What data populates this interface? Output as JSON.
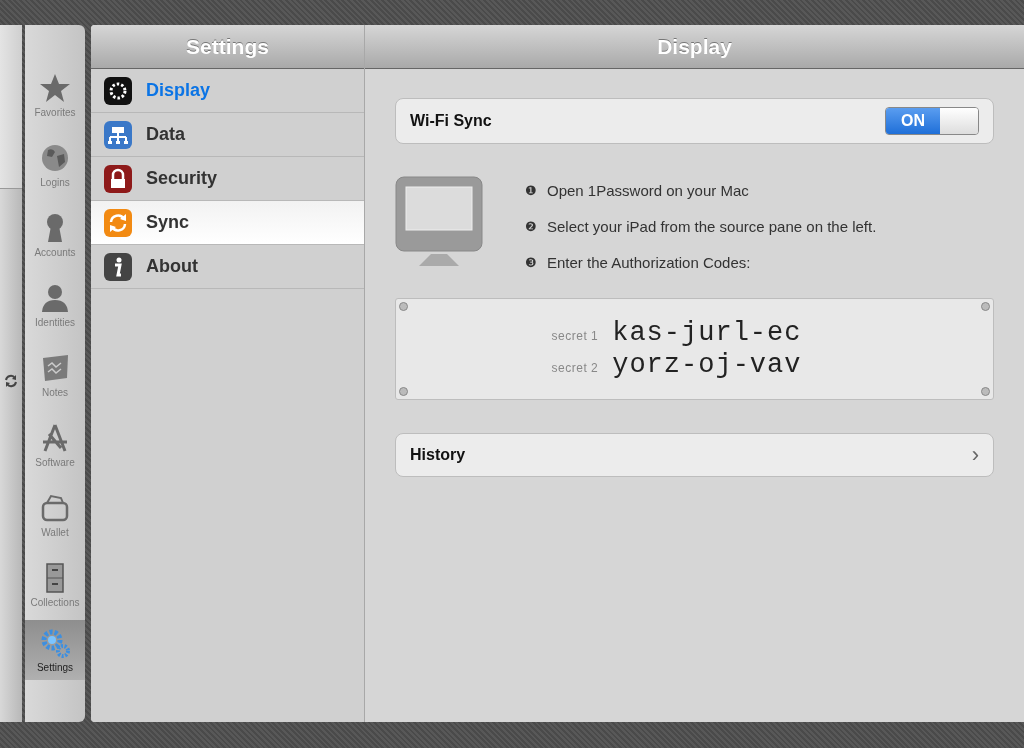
{
  "tab_bar": {
    "items": [
      {
        "label": "Favorites",
        "selected": false
      },
      {
        "label": "Logins",
        "selected": false
      },
      {
        "label": "Accounts",
        "selected": false
      },
      {
        "label": "Identities",
        "selected": false
      },
      {
        "label": "Notes",
        "selected": false
      },
      {
        "label": "Software",
        "selected": false
      },
      {
        "label": "Wallet",
        "selected": false
      },
      {
        "label": "Collections",
        "selected": false
      },
      {
        "label": "Settings",
        "selected": true
      }
    ]
  },
  "sidebar": {
    "title": "Settings",
    "items": [
      {
        "label": "Display",
        "selected": false,
        "highlighted": true
      },
      {
        "label": "Data",
        "selected": false,
        "highlighted": false
      },
      {
        "label": "Security",
        "selected": false,
        "highlighted": false
      },
      {
        "label": "Sync",
        "selected": true,
        "highlighted": false
      },
      {
        "label": "About",
        "selected": false,
        "highlighted": false
      }
    ]
  },
  "content": {
    "title": "Display",
    "wifi_sync": {
      "label": "Wi-Fi Sync",
      "on": true,
      "on_label": "ON"
    },
    "steps": [
      {
        "marker": "❶",
        "text": "Open 1Password on your Mac"
      },
      {
        "marker": "❷",
        "text": "Select your iPad from the source pane on the left."
      },
      {
        "marker": "❸",
        "text": "Enter the Authorization Codes:"
      }
    ],
    "secrets": [
      {
        "label": "secret 1",
        "code": "kas-jurl-ec"
      },
      {
        "label": "secret 2",
        "code": "yorz-oj-vav"
      }
    ],
    "history": {
      "label": "History",
      "chevron": "›"
    }
  }
}
